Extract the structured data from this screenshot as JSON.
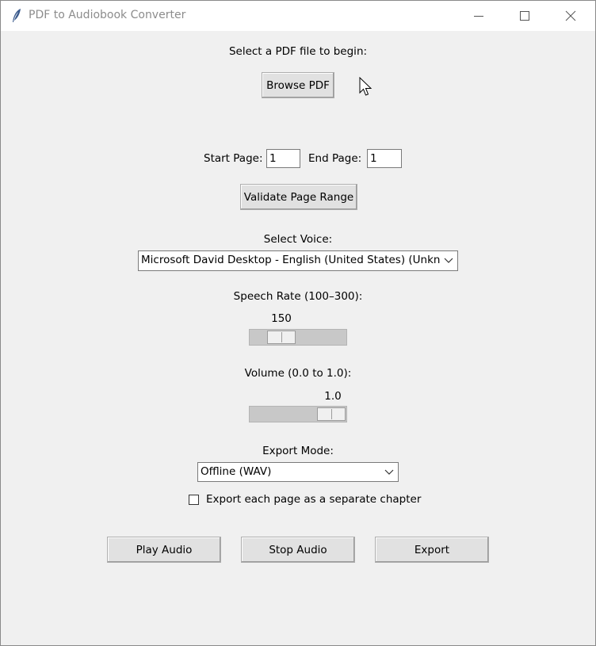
{
  "window": {
    "title": "PDF to Audiobook Converter",
    "app_icon": "feather-icon",
    "controls": [
      "minimize-icon",
      "maximize-icon",
      "close-icon"
    ]
  },
  "file": {
    "prompt": "Select a PDF file to begin:",
    "browse_label": "Browse PDF"
  },
  "pages": {
    "start_label": "Start Page:",
    "start_value": "1",
    "end_label": "End Page:",
    "end_value": "1",
    "validate_label": "Validate Page Range"
  },
  "voice": {
    "label": "Select Voice:",
    "selected": "Microsoft David Desktop - English (United States) (Unknown)"
  },
  "rate": {
    "label": "Speech Rate (100–300):",
    "value": "150",
    "min": 100,
    "max": 300,
    "current": 150
  },
  "volume": {
    "label": "Volume (0.0 to 1.0):",
    "value": "1.0",
    "min": 0.0,
    "max": 1.0,
    "current": 1.0
  },
  "export": {
    "mode_label": "Export Mode:",
    "mode_selected": "Offline (WAV)",
    "chapter_checkbox_label": "Export each page as a separate chapter",
    "chapter_checked": false
  },
  "actions": {
    "play_label": "Play Audio",
    "stop_label": "Stop Audio",
    "export_label": "Export"
  }
}
